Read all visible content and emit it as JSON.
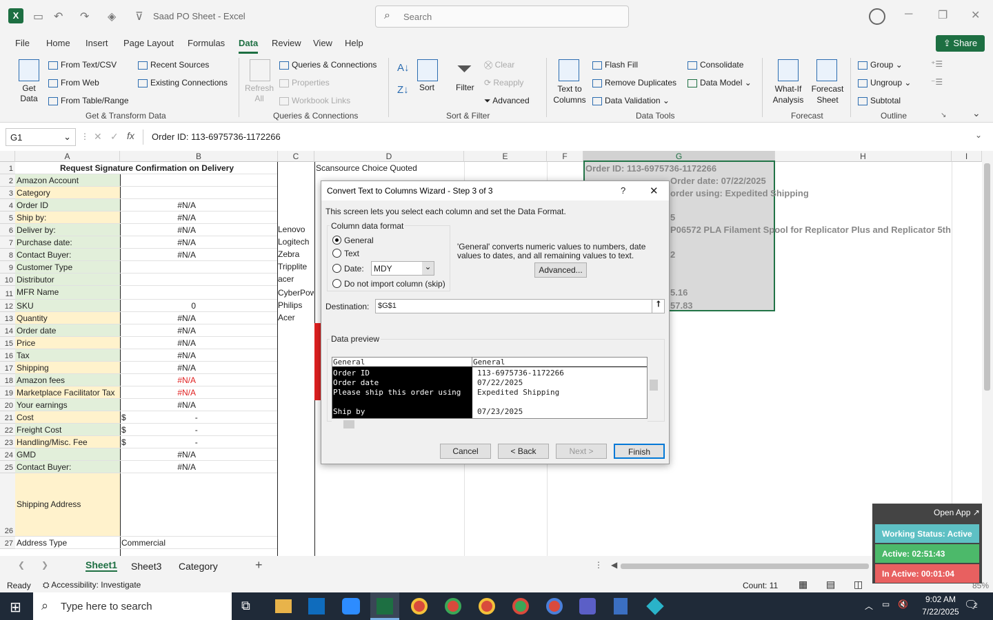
{
  "titlebar": {
    "app_logo": "X",
    "doc_title": "Saad PO Sheet  -  Excel",
    "search_placeholder": "Search"
  },
  "menu": [
    "File",
    "Home",
    "Insert",
    "Page Layout",
    "Formulas",
    "Data",
    "Review",
    "View",
    "Help"
  ],
  "share_label": "Share",
  "ribbon": {
    "get_data": "Get Data",
    "from_text_csv": "From Text/CSV",
    "from_web": "From Web",
    "from_table_range": "From Table/Range",
    "recent_sources": "Recent Sources",
    "existing_connections": "Existing Connections",
    "refresh_all": "Refresh All",
    "queries_connections": "Queries & Connections",
    "properties": "Properties",
    "workbook_links": "Workbook Links",
    "sort": "Sort",
    "filter": "Filter",
    "clear": "Clear",
    "reapply": "Reapply",
    "advanced": "Advanced",
    "text_to_columns": "Text to Columns",
    "flash_fill": "Flash Fill",
    "remove_duplicates": "Remove Duplicates",
    "data_validation": "Data Validation",
    "consolidate": "Consolidate",
    "data_model": "Data Model",
    "what_if": "What-If Analysis",
    "forecast_sheet": "Forecast Sheet",
    "group": "Group",
    "ungroup": "Ungroup",
    "subtotal": "Subtotal",
    "groups": [
      "Get & Transform Data",
      "Queries & Connections",
      "Sort & Filter",
      "Data Tools",
      "Forecast",
      "Outline"
    ]
  },
  "formula_bar": {
    "name_box": "G1",
    "formula": "Order ID: 113-6975736-1172266"
  },
  "columns": [
    "A",
    "B",
    "C",
    "D",
    "E",
    "F",
    "G",
    "H",
    "I"
  ],
  "rows": [
    {
      "n": "1",
      "a": "Request Signature Confirmation on Delivery",
      "b": ""
    },
    {
      "n": "2",
      "a": "Amazon Account",
      "b": ""
    },
    {
      "n": "3",
      "a": "Category",
      "b": ""
    },
    {
      "n": "4",
      "a": "Order ID",
      "b": "#N/A"
    },
    {
      "n": "5",
      "a": "Ship by:",
      "b": "#N/A"
    },
    {
      "n": "6",
      "a": "Deliver by:",
      "b": "#N/A"
    },
    {
      "n": "7",
      "a": "Purchase date:",
      "b": "#N/A"
    },
    {
      "n": "8",
      "a": "Contact Buyer:",
      "b": "#N/A"
    },
    {
      "n": "9",
      "a": "Customer Type",
      "b": ""
    },
    {
      "n": "10",
      "a": "Distributor",
      "b": ""
    },
    {
      "n": "11",
      "a": "MFR Name",
      "b": ""
    },
    {
      "n": "12",
      "a": "SKU",
      "b": "0"
    },
    {
      "n": "13",
      "a": "Quantity",
      "b": "#N/A"
    },
    {
      "n": "14",
      "a": "Order date",
      "b": "#N/A"
    },
    {
      "n": "15",
      "a": "Price",
      "b": "#N/A"
    },
    {
      "n": "16",
      "a": "Tax",
      "b": "#N/A"
    },
    {
      "n": "17",
      "a": "Shipping",
      "b": "#N/A"
    },
    {
      "n": "18",
      "a": "Amazon fees",
      "b": "#N/A"
    },
    {
      "n": "19",
      "a": "Marketplace Facilitator Tax",
      "b": "#N/A"
    },
    {
      "n": "20",
      "a": "Your earnings",
      "b": "#N/A"
    },
    {
      "n": "21",
      "a": "Cost",
      "b": "$                              -"
    },
    {
      "n": "22",
      "a": "Freight Cost",
      "b": "$                              -"
    },
    {
      "n": "23",
      "a": "Handling/Misc. Fee",
      "b": "$                              -"
    },
    {
      "n": "24",
      "a": "GMD",
      "b": "#N/A"
    },
    {
      "n": "25",
      "a": "Contact Buyer:",
      "b": "#N/A"
    },
    {
      "n": "26",
      "a": "Shipping Address",
      "b": ""
    },
    {
      "n": "27",
      "a": "Address Type",
      "b": "Commercial"
    }
  ],
  "col_c": [
    "Lenovo",
    "Logitech",
    "Zebra",
    "Tripplite",
    "acer",
    "CyberPow",
    "Philips",
    "Acer"
  ],
  "col_d_header": "Scansource Choice Quoted",
  "col_g": {
    "order_id": "Order ID: 113-6975736-1172266",
    "order_date": "Order date: 07/22/2025",
    "ship": "order using: Expedited Shipping",
    "r5": "5",
    "r6": "P06572 PLA Filament Spool for Replicator Plus and Replicator 5th",
    "r8": "2",
    "r11": "5.16",
    "r12": "57.83"
  },
  "dialog": {
    "title": "Convert Text to Columns Wizard - Step 3 of 3",
    "help": "?",
    "intro": "This screen lets you select each column and set the Data Format.",
    "format_group": "Column data format",
    "opt_general": "General",
    "opt_text": "Text",
    "opt_date": "Date:",
    "date_value": "MDY",
    "opt_skip": "Do not import column (skip)",
    "general_note": "'General' converts numeric values to numbers, date values to dates, and all remaining values to text.",
    "advanced_btn": "Advanced...",
    "destination_label": "Destination:",
    "destination_value": "$G$1",
    "preview_label": "Data preview",
    "preview_headers": [
      "General",
      "General"
    ],
    "preview_col1": [
      "Order ID",
      "Order date",
      "Please ship this order using",
      "",
      "Ship by"
    ],
    "preview_col2": [
      "113-6975736-1172266",
      "07/22/2025",
      "Expedited Shipping",
      "",
      "07/23/2025"
    ],
    "cancel": "Cancel",
    "back": "< Back",
    "next": "Next >",
    "finish": "Finish"
  },
  "sheet_tabs": [
    "Sheet1",
    "Sheet3",
    "Category"
  ],
  "status": {
    "ready": "Ready",
    "accessibility": "Accessibility: Investigate",
    "count": "Count: 11",
    "zoom": "85%"
  },
  "widget": {
    "open_app": "Open App ↗",
    "working": "Working Status: Active",
    "active": "Active: 02:51:43",
    "inactive": "In Active: 00:01:04"
  },
  "taskbar": {
    "search": "Type here to search",
    "time": "9:02 AM",
    "date": "7/22/2025",
    "notif": "2"
  }
}
